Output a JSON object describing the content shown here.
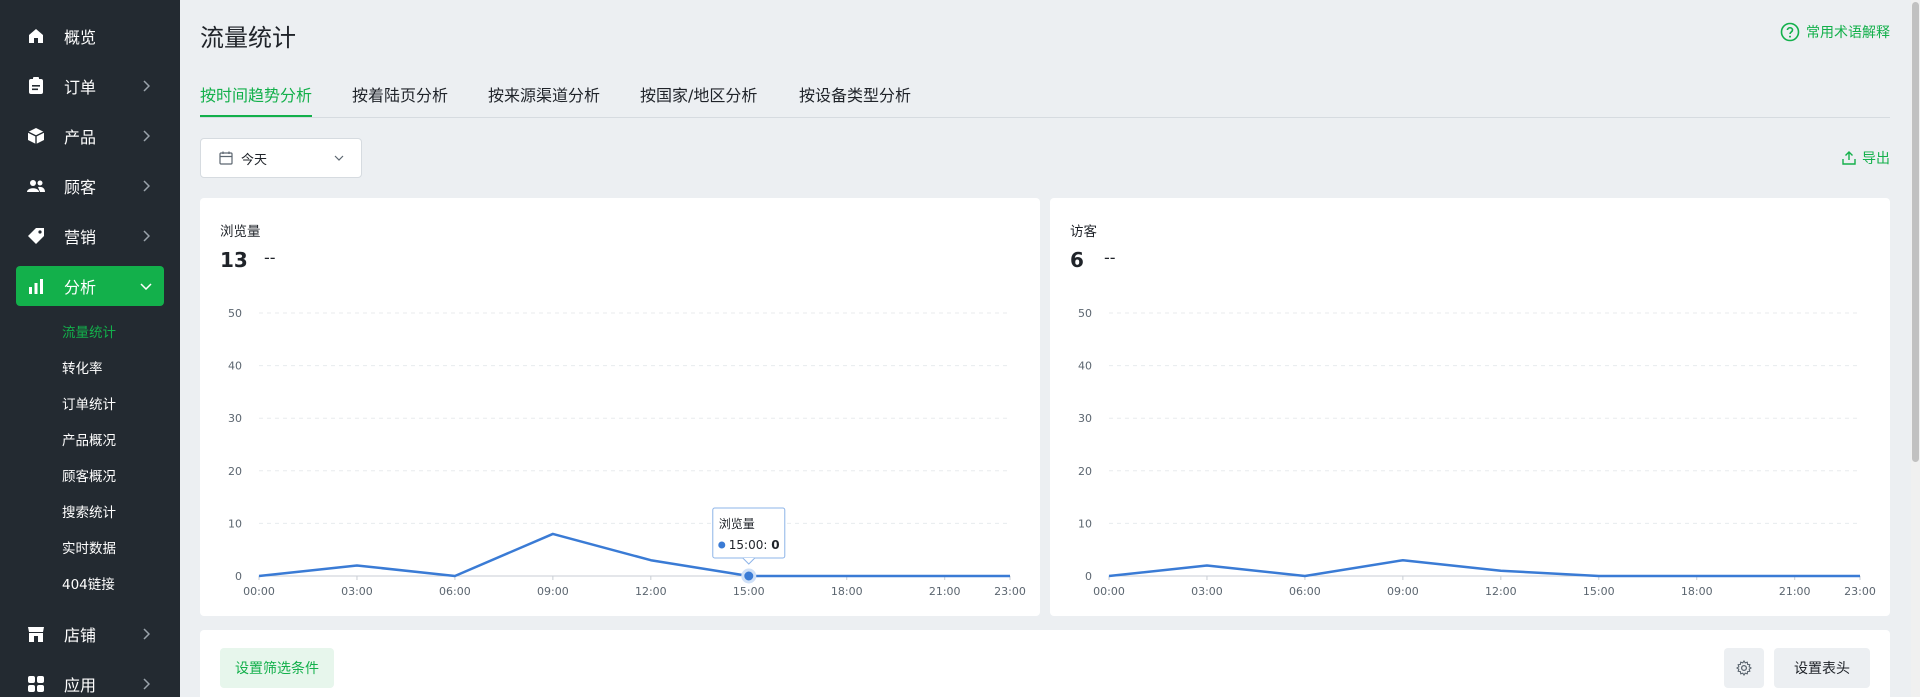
{
  "sidebar": {
    "items": [
      {
        "label": "概览",
        "icon": "home-icon",
        "has_chevron": false
      },
      {
        "label": "订单",
        "icon": "clipboard-icon",
        "has_chevron": true
      },
      {
        "label": "产品",
        "icon": "box-icon",
        "has_chevron": true
      },
      {
        "label": "顾客",
        "icon": "users-icon",
        "has_chevron": true
      },
      {
        "label": "营销",
        "icon": "tag-icon",
        "has_chevron": true
      },
      {
        "label": "分析",
        "icon": "bar-chart-icon",
        "has_chevron": true,
        "active": true
      },
      {
        "label": "店铺",
        "icon": "store-icon",
        "has_chevron": true
      },
      {
        "label": "应用",
        "icon": "apps-icon",
        "has_chevron": true
      }
    ],
    "sub_items": [
      "流量统计",
      "转化率",
      "订单统计",
      "产品概况",
      "顾客概况",
      "搜索统计",
      "实时数据",
      "404链接"
    ],
    "active_sub": "流量统计",
    "active_color": "#13b04b"
  },
  "page": {
    "title": "流量统计",
    "help_label": "常用术语解释",
    "export_label": "导出"
  },
  "tabs": [
    "按时间趋势分析",
    "按着陆页分析",
    "按来源渠道分析",
    "按国家/地区分析",
    "按设备类型分析"
  ],
  "date_filter": {
    "selected": "今天"
  },
  "cards": [
    {
      "title": "浏览量",
      "value": "13",
      "delta": "--"
    },
    {
      "title": "访客",
      "value": "6",
      "delta": "--"
    }
  ],
  "tooltip": {
    "title": "浏览量",
    "label": "15:00:",
    "value": "0"
  },
  "filter_bar": {
    "filter_label": "设置筛选条件",
    "header_label": "设置表头"
  },
  "chart_data": [
    {
      "type": "line",
      "title": "浏览量",
      "x": [
        "00:00",
        "03:00",
        "06:00",
        "09:00",
        "12:00",
        "15:00",
        "18:00",
        "21:00",
        "23:00"
      ],
      "series": [
        {
          "values": [
            0,
            2,
            0,
            8,
            3,
            0,
            0,
            0,
            0
          ]
        }
      ],
      "ylim": [
        0,
        50
      ],
      "yticks": [
        0,
        10,
        20,
        30,
        40,
        50
      ],
      "grid": true,
      "color": "#3a7bd5"
    },
    {
      "type": "line",
      "title": "访客",
      "x": [
        "00:00",
        "03:00",
        "06:00",
        "09:00",
        "12:00",
        "15:00",
        "18:00",
        "21:00",
        "23:00"
      ],
      "series": [
        {
          "values": [
            0,
            2,
            0,
            3,
            1,
            0,
            0,
            0,
            0
          ]
        }
      ],
      "ylim": [
        0,
        50
      ],
      "yticks": [
        0,
        10,
        20,
        30,
        40,
        50
      ],
      "grid": true,
      "color": "#3a7bd5"
    }
  ]
}
